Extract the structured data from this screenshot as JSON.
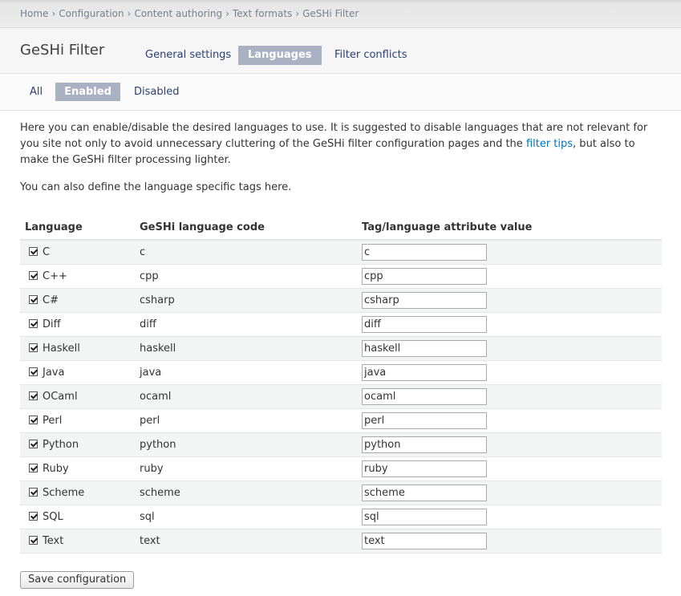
{
  "breadcrumb": [
    "Home",
    "Configuration",
    "Content authoring",
    "Text formats",
    "GeSHi Filter"
  ],
  "breadcrumb_separator": "›",
  "page_title": "GeSHi Filter",
  "primary_tabs": [
    {
      "label": "General settings",
      "active": false
    },
    {
      "label": "Languages",
      "active": true
    },
    {
      "label": "Filter conflicts",
      "active": false
    }
  ],
  "secondary_tabs": [
    {
      "label": "All",
      "active": false
    },
    {
      "label": "Enabled",
      "active": true
    },
    {
      "label": "Disabled",
      "active": false
    }
  ],
  "description": {
    "part1": "Here you can enable/disable the desired languages to use. It is suggested to disable languages that are not relevant for you site not only to avoid unnecessary cluttering of the GeSHi filter configuration pages and the ",
    "link": "filter tips",
    "part2": ", but also to make the GeSHi filter processing lighter.",
    "line2": "You can also define the language specific tags here."
  },
  "table": {
    "headers": [
      "Language",
      "GeSHi language code",
      "Tag/language attribute value"
    ],
    "rows": [
      {
        "language": "C",
        "code": "c",
        "tag": "c",
        "checked": true
      },
      {
        "language": "C++",
        "code": "cpp",
        "tag": "cpp",
        "checked": true
      },
      {
        "language": "C#",
        "code": "csharp",
        "tag": "csharp",
        "checked": true
      },
      {
        "language": "Diff",
        "code": "diff",
        "tag": "diff",
        "checked": true
      },
      {
        "language": "Haskell",
        "code": "haskell",
        "tag": "haskell",
        "checked": true
      },
      {
        "language": "Java",
        "code": "java",
        "tag": "java",
        "checked": true
      },
      {
        "language": "OCaml",
        "code": "ocaml",
        "tag": "ocaml",
        "checked": true
      },
      {
        "language": "Perl",
        "code": "perl",
        "tag": "perl",
        "checked": true
      },
      {
        "language": "Python",
        "code": "python",
        "tag": "python",
        "checked": true
      },
      {
        "language": "Ruby",
        "code": "ruby",
        "tag": "ruby",
        "checked": true
      },
      {
        "language": "Scheme",
        "code": "scheme",
        "tag": "scheme",
        "checked": true
      },
      {
        "language": "SQL",
        "code": "sql",
        "tag": "sql",
        "checked": true
      },
      {
        "language": "Text",
        "code": "text",
        "tag": "text",
        "checked": true
      }
    ]
  },
  "save_label": "Save configuration",
  "colors": {
    "link": "#0074bd",
    "tab_text": "#2a3f73",
    "active_tab_bg": "#aab1c2",
    "row_alt_bg": "#f3f4f4"
  },
  "icons": {
    "checkbox": "checkbox-checked-icon"
  }
}
